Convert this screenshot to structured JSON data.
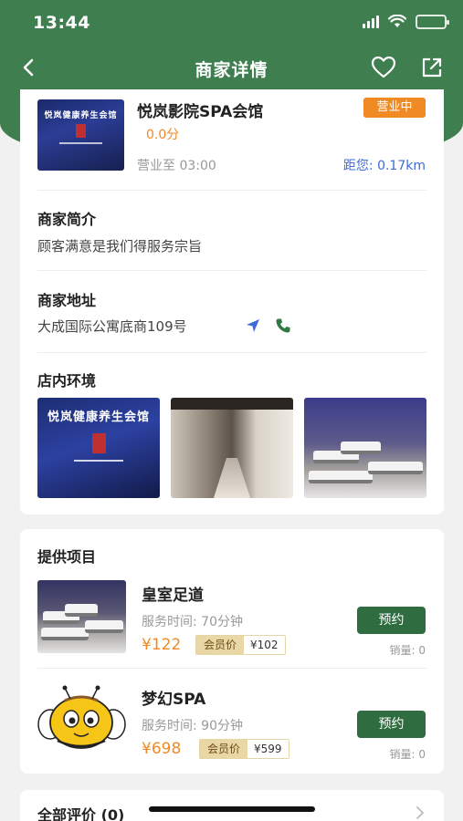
{
  "status": {
    "time": "13:44"
  },
  "nav": {
    "title": "商家详情"
  },
  "shop": {
    "name": "悦岚影院SPA会馆",
    "rating": "0.0分",
    "hours": "营业至 03:00",
    "badge": "营业中",
    "distance_label": "距您:",
    "distance_value": "0.17km",
    "thumb_sign": "悦岚健康养生会馆"
  },
  "intro": {
    "title": "商家简介",
    "text": "顾客满意是我们得服务宗旨"
  },
  "address": {
    "title": "商家地址",
    "text": "大成国际公寓底商109号"
  },
  "environment": {
    "title": "店内环境",
    "sign": "悦岚健康养生会馆"
  },
  "items": {
    "title": "提供项目",
    "list": [
      {
        "name": "皇室足道",
        "time": "服务时间: 70分钟",
        "price": "¥122",
        "member_label": "会员价",
        "member_price": "¥102",
        "button": "预约",
        "sales": "销量: 0"
      },
      {
        "name": "梦幻SPA",
        "time": "服务时间: 90分钟",
        "price": "¥698",
        "member_label": "会员价",
        "member_price": "¥599",
        "button": "预约",
        "sales": "销量: 0"
      }
    ]
  },
  "reviews": {
    "title": "全部评价 (0)"
  },
  "colors": {
    "brand_green": "#3f7e4f",
    "button_green": "#2f6c3f",
    "accent_orange": "#f08a24",
    "link_blue": "#3f6ad8"
  }
}
